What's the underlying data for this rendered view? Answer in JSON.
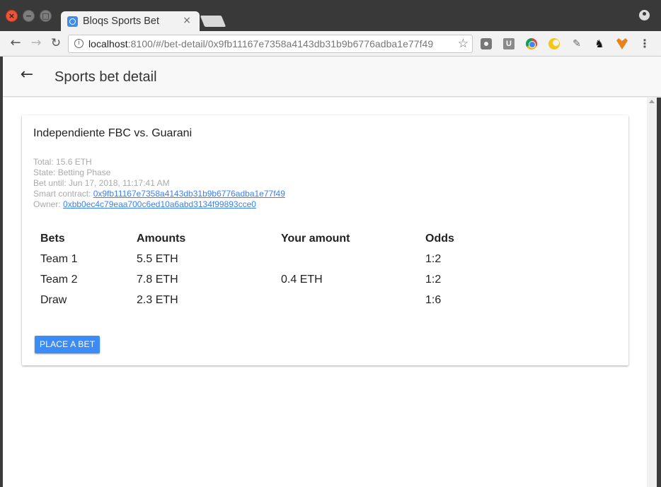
{
  "browser": {
    "tab_title": "Bloqs Sports Bet",
    "tab_close": "×",
    "url_host": "localhost",
    "url_rest": ":8100/#/bet-detail/0x9fb11167e7358a4143db31b9b6776adba1e77f49",
    "ext_u_label": "U",
    "icons": [
      "back-icon",
      "forward-icon",
      "reload-icon",
      "info-icon",
      "star-icon",
      "camera-icon",
      "u-extension-icon",
      "chrome-icon",
      "moon-icon",
      "pencil-icon",
      "github-icon",
      "metamask-icon",
      "menu-icon",
      "profile-icon"
    ]
  },
  "header": {
    "title": "Sports bet detail"
  },
  "bet": {
    "match_title": "Independiente FBC vs. Guarani",
    "total": "Total: 15.6 ETH",
    "state": "State: Betting Phase",
    "bet_until": "Bet until: Jun 17, 2018, 11:17:41 AM",
    "contract_label": "Smart contract: ",
    "contract_address": "0x9fb11167e7358a4143db31b9b6776adba1e77f49",
    "owner_label": "Owner: ",
    "owner_address": "0xbb0ec4c79eaa700c6ed10a6abd3134f99893cce0",
    "table": {
      "headers": [
        "Bets",
        "Amounts",
        "Your amount",
        "Odds"
      ],
      "rows": [
        [
          "Team 1",
          "5.5 ETH",
          "",
          "1:2"
        ],
        [
          "Team 2",
          "7.8 ETH",
          "0.4 ETH",
          "1:2"
        ],
        [
          "Draw",
          "2.3 ETH",
          "",
          "1:6"
        ]
      ]
    },
    "place_bet_label": "PLACE A BET"
  }
}
